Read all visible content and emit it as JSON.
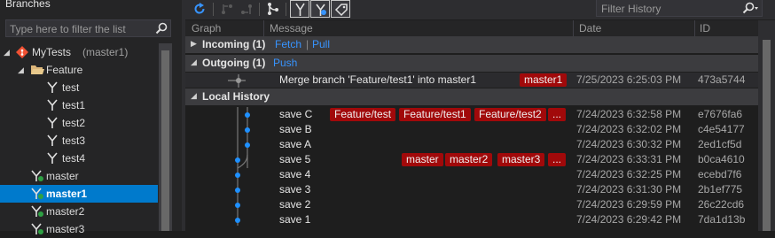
{
  "branches_panel": {
    "title": "Branches",
    "filter_placeholder": "Type here to filter the list",
    "tree": [
      {
        "label": "MyTests",
        "suffix": "(master1)",
        "icon": "git-repo-icon",
        "expander": "expanded"
      },
      {
        "label": "Feature",
        "icon": "folder-open-icon",
        "expander": "expanded"
      },
      {
        "label": "test",
        "icon": "branch-icon"
      },
      {
        "label": "test1",
        "icon": "branch-icon"
      },
      {
        "label": "test2",
        "icon": "branch-icon"
      },
      {
        "label": "test3",
        "icon": "branch-icon"
      },
      {
        "label": "test4",
        "icon": "branch-icon"
      },
      {
        "label": "master",
        "icon": "branch-local-icon"
      },
      {
        "label": "master1",
        "icon": "branch-local-icon",
        "selected": true
      },
      {
        "label": "master2",
        "icon": "branch-local-icon"
      },
      {
        "label": "master3",
        "icon": "branch-local-icon"
      }
    ]
  },
  "toolbar": {
    "buttons": [
      {
        "name": "refresh-icon",
        "enabled": true
      },
      {
        "name": "go-to-child-icon",
        "enabled": false
      },
      {
        "name": "go-to-parent-icon",
        "enabled": false
      },
      {
        "name": "graph-line-icon",
        "enabled": true
      },
      {
        "name": "show-remote-branches-icon",
        "enabled": true,
        "toggled": true
      },
      {
        "name": "show-local-branches-icon",
        "enabled": true,
        "toggled": true
      },
      {
        "name": "show-tags-icon",
        "enabled": true,
        "toggled": true
      }
    ],
    "filter_placeholder": "Filter History"
  },
  "columns": {
    "graph": "Graph",
    "message": "Message",
    "date": "Date",
    "id": "ID"
  },
  "incoming": {
    "title": "Incoming (1)",
    "fetch": "Fetch",
    "separator": "|",
    "pull": "Pull"
  },
  "outgoing": {
    "title": "Outgoing (1)",
    "push": "Push",
    "commit": {
      "message": "Merge branch 'Feature/test1' into master1",
      "tags": [
        "master1"
      ],
      "date": "7/25/2023 6:25:03 PM",
      "id": "473a5744"
    }
  },
  "local_history": {
    "title": "Local History",
    "commits": [
      {
        "message": "save C",
        "tags": [
          "Feature/test",
          "Feature/test1",
          "Feature/test2",
          "..."
        ],
        "date": "7/24/2023 6:32:58 PM",
        "id": "e7676fa6"
      },
      {
        "message": "save B",
        "tags": [],
        "date": "7/24/2023 6:32:02 PM",
        "id": "c4e54177"
      },
      {
        "message": "save A",
        "tags": [],
        "date": "7/24/2023 6:30:32 PM",
        "id": "2ed1cf5d"
      },
      {
        "message": "save 5",
        "tags": [
          "master",
          "master2",
          "master3",
          "..."
        ],
        "date": "7/24/2023 6:33:31 PM",
        "id": "b0ca4610"
      },
      {
        "message": "save 4",
        "tags": [],
        "date": "7/24/2023 6:32:25 PM",
        "id": "ecebd7f6"
      },
      {
        "message": "save 3",
        "tags": [],
        "date": "7/24/2023 6:31:30 PM",
        "id": "2b1ef775"
      },
      {
        "message": "save 2",
        "tags": [],
        "date": "7/24/2023 6:29:59 PM",
        "id": "26c22cd6"
      },
      {
        "message": "save 1",
        "tags": [],
        "date": "7/24/2023 6:29:42 PM",
        "id": "7da1d13b"
      }
    ]
  },
  "colors": {
    "accent": "#007acc",
    "tag_bg": "#a1090a",
    "link": "#3794ff",
    "graph_node": "#1e90ff"
  }
}
